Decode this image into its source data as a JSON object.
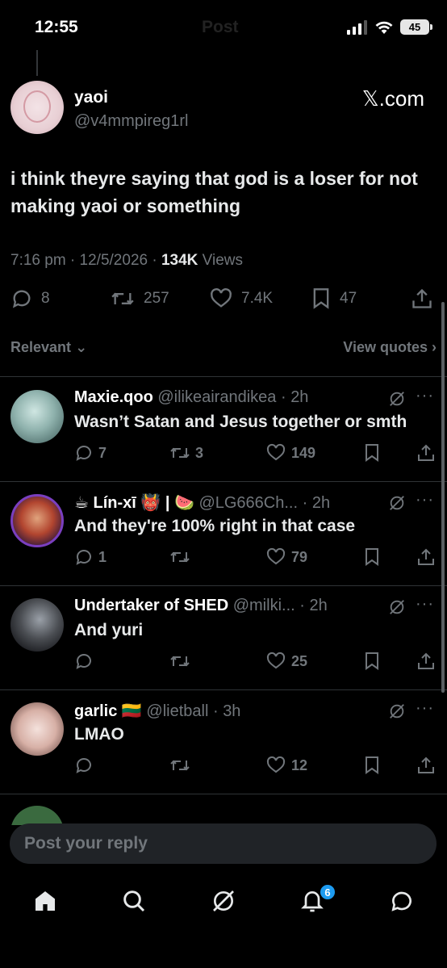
{
  "status_bar": {
    "time": "12:55",
    "battery": "45",
    "ghost_title": "Post"
  },
  "main_post": {
    "author_name": "yaoi",
    "author_handle": "@v4mmpireg1rl",
    "source_label": "𝕏.com",
    "text": "i think theyre saying that god is a loser for not making yaoi or something",
    "time": "7:16 pm",
    "date": "12/5/2026",
    "views_count": "134K",
    "views_label": "Views",
    "stats": {
      "replies": "8",
      "reposts": "257",
      "likes": "7.4K",
      "bookmarks": "47"
    }
  },
  "sort": {
    "left_label": "Relevant",
    "right_label": "View quotes"
  },
  "replies": [
    {
      "name": "Maxie.qoo",
      "handle": "@ilikeairandikea",
      "time": "2h",
      "text": "Wasn’t Satan and Jesus together or smth",
      "replies": "7",
      "reposts": "3",
      "likes": "149"
    },
    {
      "name": "☕ Lín-xī 👹 | 🍉",
      "handle": "@LG666Ch...",
      "time": "2h",
      "text": "And they're 100% right in that case",
      "replies": "1",
      "reposts": "",
      "likes": "79"
    },
    {
      "name": "Undertaker of SHED",
      "handle": "@milki...",
      "time": "2h",
      "text": "And yuri",
      "replies": "",
      "reposts": "",
      "likes": "25"
    },
    {
      "name": "garlic 🇱🇹",
      "handle": "@lietball",
      "time": "3h",
      "text": "LMAO",
      "replies": "",
      "reposts": "",
      "likes": "12"
    }
  ],
  "composer": {
    "placeholder": "Post your reply"
  },
  "nav": {
    "notifications_badge": "6"
  },
  "colors": {
    "background": "#000000",
    "text": "#e7e9ea",
    "muted": "#71767b",
    "accent": "#1d9bf0",
    "divider": "#2f3336"
  },
  "icons": [
    "home-icon",
    "search-icon",
    "grok-icon",
    "bell-icon",
    "messages-icon",
    "reply-icon",
    "repost-icon",
    "like-icon",
    "bookmark-icon",
    "share-icon"
  ]
}
